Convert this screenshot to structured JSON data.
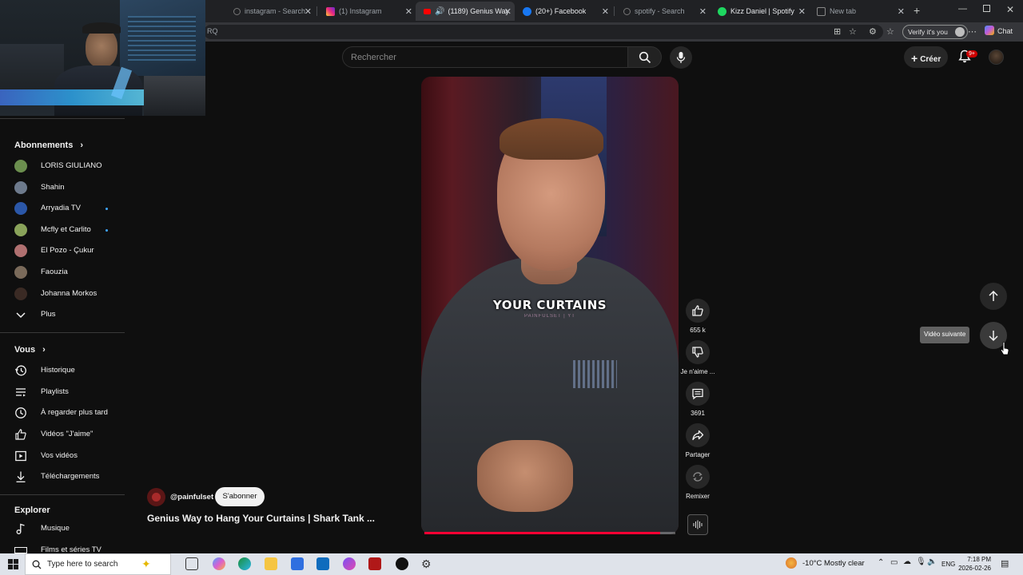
{
  "browser": {
    "tabs": [
      {
        "title": "instagram - Search",
        "icon": "search-icon",
        "active": false
      },
      {
        "title": "(1) Instagram",
        "icon": "instagram-icon",
        "active": false
      },
      {
        "title": "(1189) Genius Way",
        "icon": "youtube-icon",
        "active": true
      },
      {
        "title": "(20+) Facebook",
        "icon": "facebook-icon",
        "active": false
      },
      {
        "title": "spotify - Search",
        "icon": "search-icon",
        "active": false
      },
      {
        "title": "Kizz Daniel | Spotify",
        "icon": "spotify-icon",
        "active": false
      },
      {
        "title": "New tab",
        "icon": "newtab-icon",
        "active": false
      }
    ],
    "address_fragment": "RQ",
    "verify_label": "Verify it's you",
    "chat_label": "Chat"
  },
  "masthead": {
    "search_placeholder": "Rechercher",
    "create_label": "Créer",
    "notifications_badge": "9+"
  },
  "sidebar": {
    "subscriptions_heading": "Abonnements",
    "subscriptions": [
      {
        "name": "LORIS GIULIANO",
        "color": "#6b8e4e",
        "new": false
      },
      {
        "name": "Shahin",
        "color": "#6d7a8c",
        "new": false
      },
      {
        "name": "Arryadia TV",
        "color": "#2b57a8",
        "new": true
      },
      {
        "name": "Mcfly et Carlito",
        "color": "#8aa35a",
        "new": true
      },
      {
        "name": "El Pozo - Çukur",
        "color": "#b07070",
        "new": false
      },
      {
        "name": "Faouzia",
        "color": "#7a6a5a",
        "new": false
      },
      {
        "name": "Johanna Morkos",
        "color": "#3a2a24",
        "new": false
      }
    ],
    "more_label": "Plus",
    "you_heading": "Vous",
    "you_items": [
      {
        "label": "Historique",
        "icon": "history-icon"
      },
      {
        "label": "Playlists",
        "icon": "playlists-icon"
      },
      {
        "label": "À regarder plus tard",
        "icon": "watch-later-icon"
      },
      {
        "label": "Vidéos \"J'aime\"",
        "icon": "liked-videos-icon"
      },
      {
        "label": "Vos vidéos",
        "icon": "your-videos-icon"
      },
      {
        "label": "Téléchargements",
        "icon": "downloads-icon"
      }
    ],
    "explore_heading": "Explorer",
    "explore_items": [
      {
        "label": "Musique",
        "icon": "music-icon"
      },
      {
        "label": "Films et séries TV",
        "icon": "films-icon"
      }
    ]
  },
  "short": {
    "caption": "YOUR CURTAINS",
    "watermark": "PAINFULSET | YT",
    "progress": 0.94,
    "channel": "@painfulset",
    "subscribe_label": "S'abonner",
    "title": "Genius Way to Hang Your Curtains | Shark Tank ...",
    "actions": {
      "likes": "655 k",
      "dislike_label": "Je n'aime ...",
      "comments": "3691",
      "share_label": "Partager",
      "remix_label": "Remixer"
    }
  },
  "navigation": {
    "next_tooltip": "Vidéo suivante"
  },
  "taskbar": {
    "search_placeholder": "Type here to search",
    "weather_temp": "-10°C",
    "weather_text": "Mostly clear",
    "language": "ENG",
    "time": "7:18 PM",
    "date": "2026-02-26"
  }
}
